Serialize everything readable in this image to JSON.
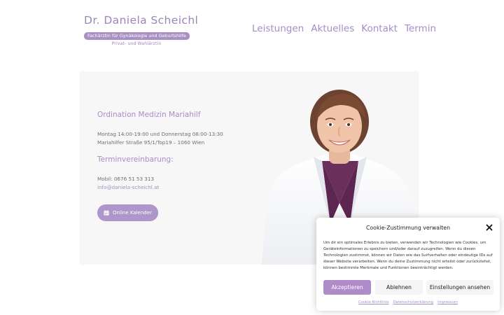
{
  "header": {
    "logo_name": "Dr. Daniela Scheichl",
    "logo_subtitle": "Fachärztin für Gynäkologie und Geburtshilfe",
    "logo_tagline": "Privat- und Wahlärztin",
    "nav": [
      {
        "label": "Leistungen"
      },
      {
        "label": "Aktuelles"
      },
      {
        "label": "Kontakt"
      },
      {
        "label": "Termin"
      }
    ]
  },
  "hero": {
    "title": "Ordination Medizin Mariahilf",
    "hours": "Montag 14:00-19:00 und Donnerstag 08:00-13:30",
    "address": "Mariahilfer Straße 95/1/Top19 – 1060 Wien",
    "appointment_title": "Terminvereinbarung:",
    "phone": "Mobil: 0676 51 53 313",
    "email": "info@daniela-scheichl.at",
    "calendar_button": "Online Kalender"
  },
  "cookie": {
    "title": "Cookie-Zustimmung verwalten",
    "text": "Um dir ein optimales Erlebnis zu bieten, verwenden wir Technologien wie Cookies, um Geräteinformationen zu speichern und/oder darauf zuzugreifen. Wenn du diesen Technologien zustimmst, können wir Daten wie das Surfverhalten oder eindeutige IDs auf dieser Website verarbeiten. Wenn du deine Zustimmung nicht erteilst oder zurückziehst, können bestimmte Merkmale und Funktionen beeinträchtigt werden.",
    "accept_label": "Akzeptieren",
    "deny_label": "Ablehnen",
    "settings_label": "Einstellungen ansehen",
    "links": [
      {
        "label": "Cookie-Richtlinie"
      },
      {
        "label": "Datenschutzerklärung"
      },
      {
        "label": "Impressum"
      }
    ]
  },
  "colors": {
    "accent": "#a68dc7",
    "accept_button": "#b08bca",
    "card_background": "#f7f7f8"
  },
  "icons": {
    "calendar": "calendar-icon",
    "close": "close-icon"
  }
}
